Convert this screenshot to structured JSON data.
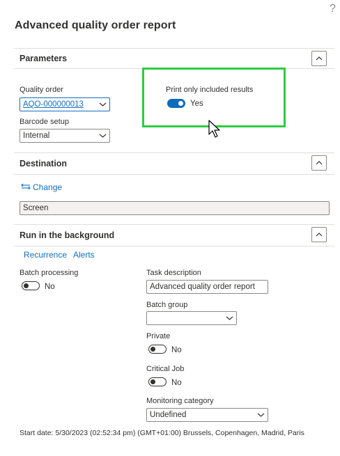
{
  "help": "?",
  "title": "Advanced quality order report",
  "parameters": {
    "section_title": "Parameters",
    "quality_order_label": "Quality order",
    "quality_order_value": "AQO-000000013",
    "barcode_setup_label": "Barcode setup",
    "barcode_setup_value": "Internal",
    "print_only_label": "Print only included results",
    "print_only_value": "Yes"
  },
  "destination": {
    "section_title": "Destination",
    "change_label": "Change",
    "destination_value": "Screen"
  },
  "background": {
    "section_title": "Run in the background",
    "recurrence_label": "Recurrence",
    "alerts_label": "Alerts",
    "batch_processing_label": "Batch processing",
    "batch_processing_value": "No",
    "task_description_label": "Task description",
    "task_description_value": "Advanced quality order report",
    "batch_group_label": "Batch group",
    "batch_group_value": "",
    "private_label": "Private",
    "private_value": "No",
    "critical_job_label": "Critical Job",
    "critical_job_value": "No",
    "monitoring_category_label": "Monitoring category",
    "monitoring_category_value": "Undefined",
    "start_date_text": "Start date: 5/30/2023 (02:52:34 pm) (GMT+01:00) Brussels, Copenhagen, Madrid, Paris"
  },
  "colors": {
    "accent": "#0f6cbd",
    "link": "#106ebe",
    "highlight": "#2ecc40"
  }
}
